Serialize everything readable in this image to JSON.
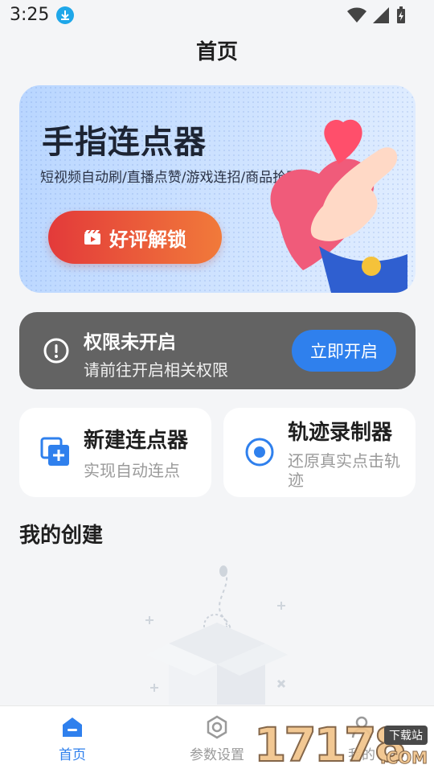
{
  "status": {
    "time": "3:25"
  },
  "header": {
    "title": "首页"
  },
  "banner": {
    "title": "手指连点器",
    "subtitle": "短视频自动刷/直播点赞/游戏连招/商品抢购",
    "button_label": "好评解锁"
  },
  "permission": {
    "title": "权限未开启",
    "description": "请前往开启相关权限",
    "button_label": "立即开启"
  },
  "features": {
    "new_clicker": {
      "title": "新建连点器",
      "description": "实现自动连点"
    },
    "trace_recorder": {
      "title": "轨迹录制器",
      "description": "还原真实点击轨迹"
    }
  },
  "section": {
    "title": "我的创建"
  },
  "nav": {
    "home": "首页",
    "settings": "参数设置",
    "mine": "我的"
  },
  "watermark": {
    "number": "17178",
    "tag": "下载站",
    "domain": ".COM"
  },
  "colors": {
    "accent": "#2f80ed",
    "card_dark": "#636363",
    "unlock_start": "#e33a3a",
    "unlock_end": "#f17a3a"
  }
}
